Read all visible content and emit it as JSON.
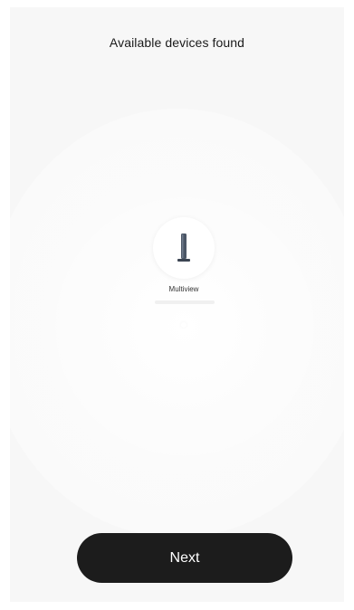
{
  "header": {
    "title": "Available devices found"
  },
  "devices": [
    {
      "name": "Multiview",
      "icon": "tower-speaker-icon"
    }
  ],
  "footer": {
    "next_label": "Next"
  },
  "colors": {
    "background": "#f7f7f7",
    "button": "#1c1c1c",
    "button_text": "#ffffff",
    "device_icon": "#4b5666"
  }
}
